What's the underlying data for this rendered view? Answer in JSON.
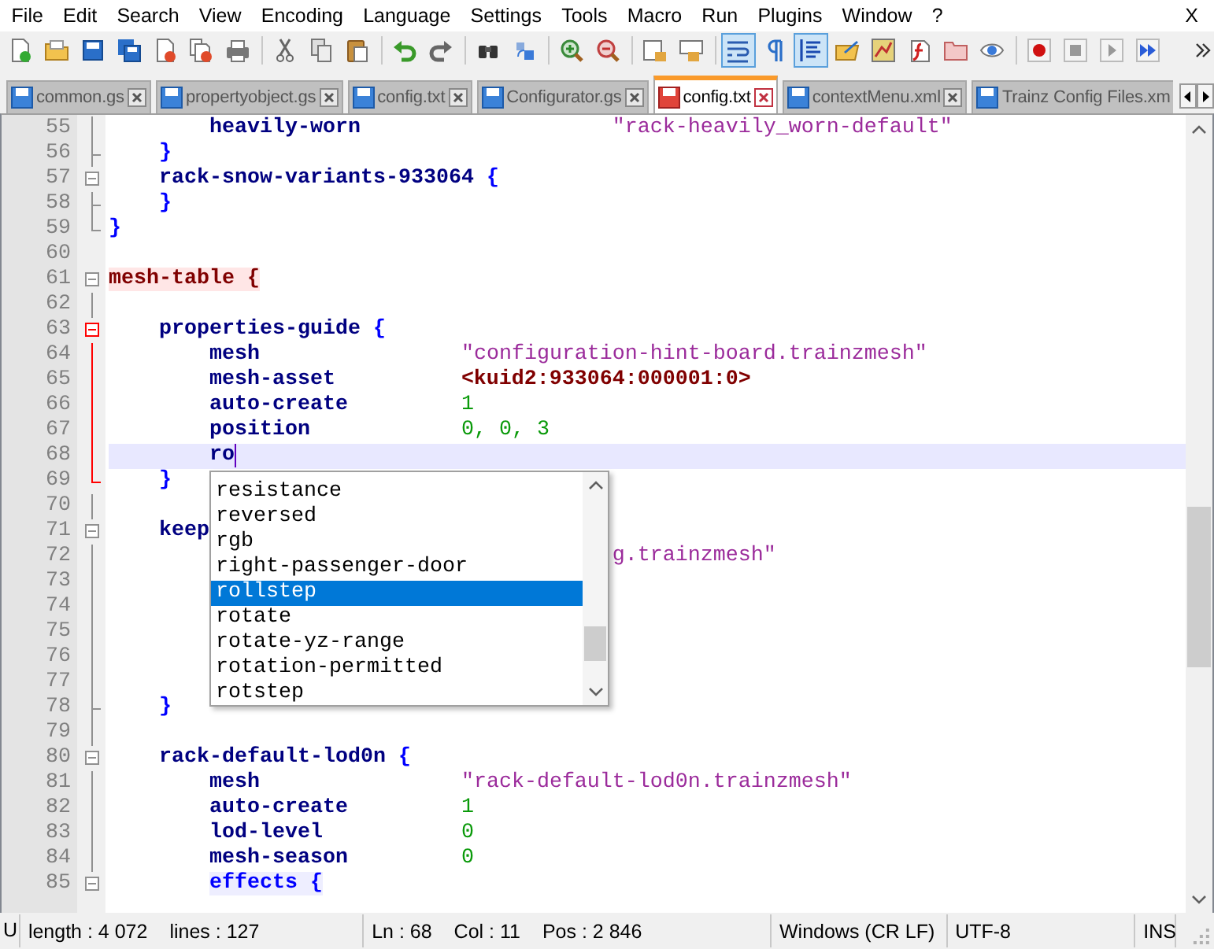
{
  "menu": [
    "File",
    "Edit",
    "Search",
    "View",
    "Encoding",
    "Language",
    "Settings",
    "Tools",
    "Macro",
    "Run",
    "Plugins",
    "Window",
    "?"
  ],
  "menu_close": "X",
  "toolbar": [
    [
      {
        "pressed": false
      },
      {
        "pressed": false
      },
      {
        "pressed": false
      },
      {
        "pressed": false
      },
      {
        "pressed": false
      },
      {
        "pressed": false
      },
      {
        "pressed": false
      }
    ],
    [
      {
        "pressed": false
      },
      {
        "pressed": false
      },
      {
        "pressed": false
      }
    ],
    [
      {
        "pressed": false
      },
      {
        "pressed": false
      }
    ],
    [
      {
        "pressed": false
      },
      {
        "pressed": false
      }
    ],
    [
      {
        "pressed": false
      },
      {
        "pressed": false
      }
    ],
    [
      {
        "pressed": false
      },
      {
        "pressed": false
      }
    ],
    [
      {
        "pressed": true
      },
      {
        "pressed": false
      },
      {
        "pressed": true
      },
      {
        "pressed": false
      },
      {
        "pressed": false
      },
      {
        "pressed": false
      },
      {
        "pressed": false
      },
      {
        "pressed": false
      }
    ],
    [
      {
        "pressed": false
      },
      {
        "pressed": false
      },
      {
        "pressed": false
      },
      {
        "pressed": false
      }
    ]
  ],
  "tabs": [
    {
      "label": "common.gs",
      "selected": false,
      "modified": false,
      "clipped": false
    },
    {
      "label": "propertyobject.gs",
      "selected": false,
      "modified": false,
      "clipped": false
    },
    {
      "label": "config.txt",
      "selected": false,
      "modified": false,
      "clipped": false
    },
    {
      "label": "Configurator.gs",
      "selected": false,
      "modified": false,
      "clipped": false
    },
    {
      "label": "config.txt",
      "selected": true,
      "modified": true,
      "clipped": false
    },
    {
      "label": "contextMenu.xml",
      "selected": false,
      "modified": false,
      "clipped": false
    },
    {
      "label": "Trainz Config Files.xm",
      "selected": false,
      "modified": false,
      "clipped": true
    }
  ],
  "editor": {
    "lines": [
      {
        "number": "55",
        "kind": "line",
        "active": false,
        "current": false,
        "segments": [
          {
            "text": "heavily-worn",
            "kind": "key"
          },
          {
            "text": "\"rack-heavily_worn-default\"",
            "kind": "string"
          }
        ]
      },
      {
        "number": "56",
        "kind": "end",
        "active": false,
        "current": false,
        "segments": [
          {
            "text": "}",
            "kind": "brace"
          }
        ]
      },
      {
        "number": "57",
        "kind": "box",
        "active": false,
        "current": false,
        "segments": [
          {
            "text": "rack-snow-variants-933064",
            "kind": "key"
          },
          {
            "text": "{",
            "kind": "brace"
          }
        ]
      },
      {
        "number": "58",
        "kind": "end",
        "active": false,
        "current": false,
        "segments": [
          {
            "text": "}",
            "kind": "brace"
          }
        ]
      },
      {
        "number": "59",
        "kind": "corner",
        "active": false,
        "current": false,
        "segments": [
          {
            "text": "}",
            "kind": "brace"
          }
        ]
      },
      {
        "number": "60",
        "kind": "none"
      },
      {
        "number": "61",
        "kind": "box",
        "active": false,
        "current": false,
        "segments": [
          {
            "text": "mesh-table {",
            "kind": "section"
          }
        ]
      },
      {
        "number": "62",
        "kind": "line",
        "active": false
      },
      {
        "number": "63",
        "kind": "box",
        "active": true,
        "current": false,
        "segments": [
          {
            "text": "properties-guide",
            "kind": "key"
          },
          {
            "text": "{",
            "kind": "brace"
          }
        ]
      },
      {
        "number": "64",
        "kind": "line",
        "active": true,
        "current": false,
        "segments": [
          {
            "text": "mesh",
            "kind": "key"
          },
          {
            "text": "\"configuration-hint-board.trainzmesh\"",
            "kind": "string"
          }
        ]
      },
      {
        "number": "65",
        "kind": "line",
        "active": true,
        "current": false,
        "segments": [
          {
            "text": "mesh-asset",
            "kind": "key"
          },
          {
            "text": "<kuid2:933064:000001:0>",
            "kind": "kuid"
          }
        ]
      },
      {
        "number": "66",
        "kind": "line",
        "active": true,
        "current": false,
        "segments": [
          {
            "text": "auto-create",
            "kind": "key"
          },
          {
            "text": "1",
            "kind": "number"
          }
        ]
      },
      {
        "number": "67",
        "kind": "line",
        "active": true,
        "current": false,
        "segments": [
          {
            "text": "position",
            "kind": "key"
          },
          {
            "text": "0, 0, 3",
            "kind": "number"
          }
        ]
      },
      {
        "number": "68",
        "kind": "line",
        "active": true,
        "current": true,
        "segments": [
          {
            "text": "ro",
            "kind": "key"
          }
        ]
      },
      {
        "number": "69",
        "kind": "corner",
        "active": true,
        "current": false,
        "segments": [
          {
            "text": "}",
            "kind": "brace"
          }
        ]
      },
      {
        "number": "70",
        "kind": "line",
        "active": false
      },
      {
        "number": "71",
        "kind": "box",
        "active": false,
        "current": false,
        "segments": [
          {
            "text": "keep",
            "kind": "key"
          }
        ]
      },
      {
        "number": "72",
        "kind": "line",
        "active": false,
        "current": false,
        "segments": [
          {
            "text": "g.trainzmesh\"",
            "kind": "string"
          }
        ]
      },
      {
        "number": "73",
        "kind": "line",
        "active": false
      },
      {
        "number": "74",
        "kind": "line",
        "active": false
      },
      {
        "number": "75",
        "kind": "line",
        "active": false
      },
      {
        "number": "76",
        "kind": "line",
        "active": false
      },
      {
        "number": "77",
        "kind": "line",
        "active": false
      },
      {
        "number": "78",
        "kind": "end",
        "active": false,
        "current": false,
        "segments": [
          {
            "text": "}",
            "kind": "brace"
          }
        ]
      },
      {
        "number": "79",
        "kind": "line",
        "active": false
      },
      {
        "number": "80",
        "kind": "box",
        "active": false,
        "current": false,
        "segments": [
          {
            "text": "rack-default-lod0n",
            "kind": "key"
          },
          {
            "text": "{",
            "kind": "brace"
          }
        ]
      },
      {
        "number": "81",
        "kind": "line",
        "active": false,
        "current": false,
        "segments": [
          {
            "text": "mesh",
            "kind": "key"
          },
          {
            "text": "\"rack-default-lod0n.trainzmesh\"",
            "kind": "string"
          }
        ]
      },
      {
        "number": "82",
        "kind": "line",
        "active": false,
        "current": false,
        "segments": [
          {
            "text": "auto-create",
            "kind": "key"
          },
          {
            "text": "1",
            "kind": "number"
          }
        ]
      },
      {
        "number": "83",
        "kind": "line",
        "active": false,
        "current": false,
        "segments": [
          {
            "text": "lod-level",
            "kind": "key"
          },
          {
            "text": "0",
            "kind": "number"
          }
        ]
      },
      {
        "number": "84",
        "kind": "line",
        "active": false,
        "current": false,
        "segments": [
          {
            "text": "mesh-season",
            "kind": "key"
          },
          {
            "text": "0",
            "kind": "number"
          }
        ]
      },
      {
        "number": "85",
        "kind": "box",
        "active": false,
        "current": false,
        "segments": [
          {
            "text": "effects {",
            "kind": "block"
          }
        ]
      }
    ]
  },
  "autocomplete": [
    {
      "label": "resistance",
      "selected": false
    },
    {
      "label": "reversed",
      "selected": false
    },
    {
      "label": "rgb",
      "selected": false
    },
    {
      "label": "right-passenger-door",
      "selected": false
    },
    {
      "label": "rollstep",
      "selected": true
    },
    {
      "label": "rotate",
      "selected": false
    },
    {
      "label": "rotate-yz-range",
      "selected": false
    },
    {
      "label": "rotation-permitted",
      "selected": false
    },
    {
      "label": "rotstep",
      "selected": false
    }
  ],
  "status_bar": {
    "fragment": "U",
    "sections": [
      [
        "length : 4 072",
        "lines : 127"
      ],
      [
        "Ln : 68",
        "Col : 11",
        "Pos : 2 846"
      ],
      [
        "Windows (CR LF)"
      ],
      [
        "UTF-8"
      ],
      [
        "INS"
      ]
    ]
  }
}
